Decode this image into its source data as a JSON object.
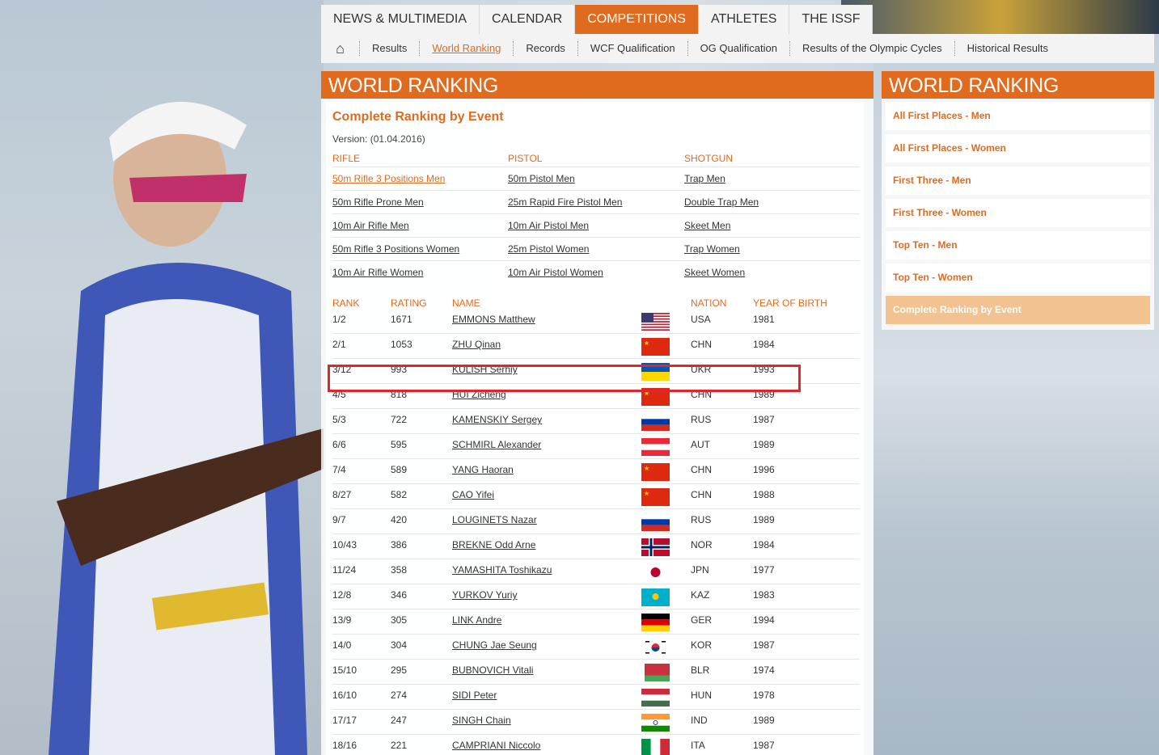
{
  "nav": {
    "tabs": [
      {
        "label": "NEWS & MULTIMEDIA",
        "active": false
      },
      {
        "label": "CALENDAR",
        "active": false
      },
      {
        "label": "COMPETITIONS",
        "active": true
      },
      {
        "label": "ATHLETES",
        "active": false
      },
      {
        "label": "THE ISSF",
        "active": false
      }
    ],
    "home_icon": "home-icon",
    "sub": [
      {
        "label": "Results",
        "active": false
      },
      {
        "label": "World Ranking",
        "active": true
      },
      {
        "label": "Records",
        "active": false
      },
      {
        "label": "WCF Qualification",
        "active": false
      },
      {
        "label": "OG Qualification",
        "active": false
      },
      {
        "label": "Results of the Olympic Cycles",
        "active": false
      },
      {
        "label": "Historical Results",
        "active": false
      }
    ]
  },
  "main": {
    "title": "WORLD RANKING",
    "section_title": "Complete Ranking by Event",
    "version": "Version: (01.04.2016)",
    "categories": [
      {
        "name": "RIFLE",
        "events": [
          "50m Rifle 3 Positions Men",
          "50m Rifle Prone Men",
          "10m Air Rifle Men",
          "50m Rifle 3 Positions Women",
          "10m Air Rifle Women"
        ]
      },
      {
        "name": "PISTOL",
        "events": [
          "50m Pistol Men",
          "25m Rapid Fire Pistol Men",
          "10m Air Pistol Men",
          "25m Pistol Women",
          "10m Air Pistol Women"
        ]
      },
      {
        "name": "SHOTGUN",
        "events": [
          "Trap Men",
          "Double Trap Men",
          "Skeet Men",
          "Trap Women",
          "Skeet Women"
        ]
      }
    ],
    "active_event": "50m Rifle 3 Positions Men",
    "table": {
      "headers": {
        "rank": "RANK",
        "rating": "RATING",
        "name": "NAME",
        "nation": "NATION",
        "year": "YEAR OF BIRTH"
      },
      "rows": [
        {
          "rank": "1/2",
          "rating": "1671",
          "name": "EMMONS Matthew",
          "nation": "USA",
          "year": "1981"
        },
        {
          "rank": "2/1",
          "rating": "1053",
          "name": "ZHU Qinan",
          "nation": "CHN",
          "year": "1984"
        },
        {
          "rank": "3/12",
          "rating": "993",
          "name": "KULISH Serhiy",
          "nation": "UKR",
          "year": "1993"
        },
        {
          "rank": "4/5",
          "rating": "818",
          "name": "HUI Zicheng",
          "nation": "CHN",
          "year": "1989"
        },
        {
          "rank": "5/3",
          "rating": "722",
          "name": "KAMENSKIY Sergey",
          "nation": "RUS",
          "year": "1987"
        },
        {
          "rank": "6/6",
          "rating": "595",
          "name": "SCHMIRL Alexander",
          "nation": "AUT",
          "year": "1989"
        },
        {
          "rank": "7/4",
          "rating": "589",
          "name": "YANG Haoran",
          "nation": "CHN",
          "year": "1996"
        },
        {
          "rank": "8/27",
          "rating": "582",
          "name": "CAO Yifei",
          "nation": "CHN",
          "year": "1988"
        },
        {
          "rank": "9/7",
          "rating": "420",
          "name": "LOUGINETS Nazar",
          "nation": "RUS",
          "year": "1989"
        },
        {
          "rank": "10/43",
          "rating": "386",
          "name": "BREKNE Odd Arne",
          "nation": "NOR",
          "year": "1984"
        },
        {
          "rank": "11/24",
          "rating": "358",
          "name": "YAMASHITA Toshikazu",
          "nation": "JPN",
          "year": "1977"
        },
        {
          "rank": "12/8",
          "rating": "346",
          "name": "YURKOV Yuriy",
          "nation": "KAZ",
          "year": "1983"
        },
        {
          "rank": "13/9",
          "rating": "305",
          "name": "LINK Andre",
          "nation": "GER",
          "year": "1994"
        },
        {
          "rank": "14/0",
          "rating": "304",
          "name": "CHUNG Jae Seung",
          "nation": "KOR",
          "year": "1987"
        },
        {
          "rank": "15/10",
          "rating": "295",
          "name": "BUBNOVICH Vitali",
          "nation": "BLR",
          "year": "1974"
        },
        {
          "rank": "16/10",
          "rating": "274",
          "name": "SIDI Peter",
          "nation": "HUN",
          "year": "1978"
        },
        {
          "rank": "17/17",
          "rating": "247",
          "name": "SINGH Chain",
          "nation": "IND",
          "year": "1989"
        },
        {
          "rank": "18/16",
          "rating": "221",
          "name": "CAMPRIANI Niccolo",
          "nation": "ITA",
          "year": "1987"
        }
      ]
    }
  },
  "side": {
    "title": "WORLD RANKING",
    "items": [
      {
        "label": "All First Places - Men",
        "active": false
      },
      {
        "label": "All First Places - Women",
        "active": false
      },
      {
        "label": "First Three - Men",
        "active": false
      },
      {
        "label": "First Three - Women",
        "active": false
      },
      {
        "label": "Top Ten - Men",
        "active": false
      },
      {
        "label": "Top Ten - Women",
        "active": false
      },
      {
        "label": "Complete Ranking by Event",
        "active": true
      }
    ]
  },
  "colors": {
    "accent": "#e06a1d",
    "highlight_box": "#e2242b",
    "side_active": "#f2c291"
  },
  "highlighted_row": "KULISH Serhiy"
}
